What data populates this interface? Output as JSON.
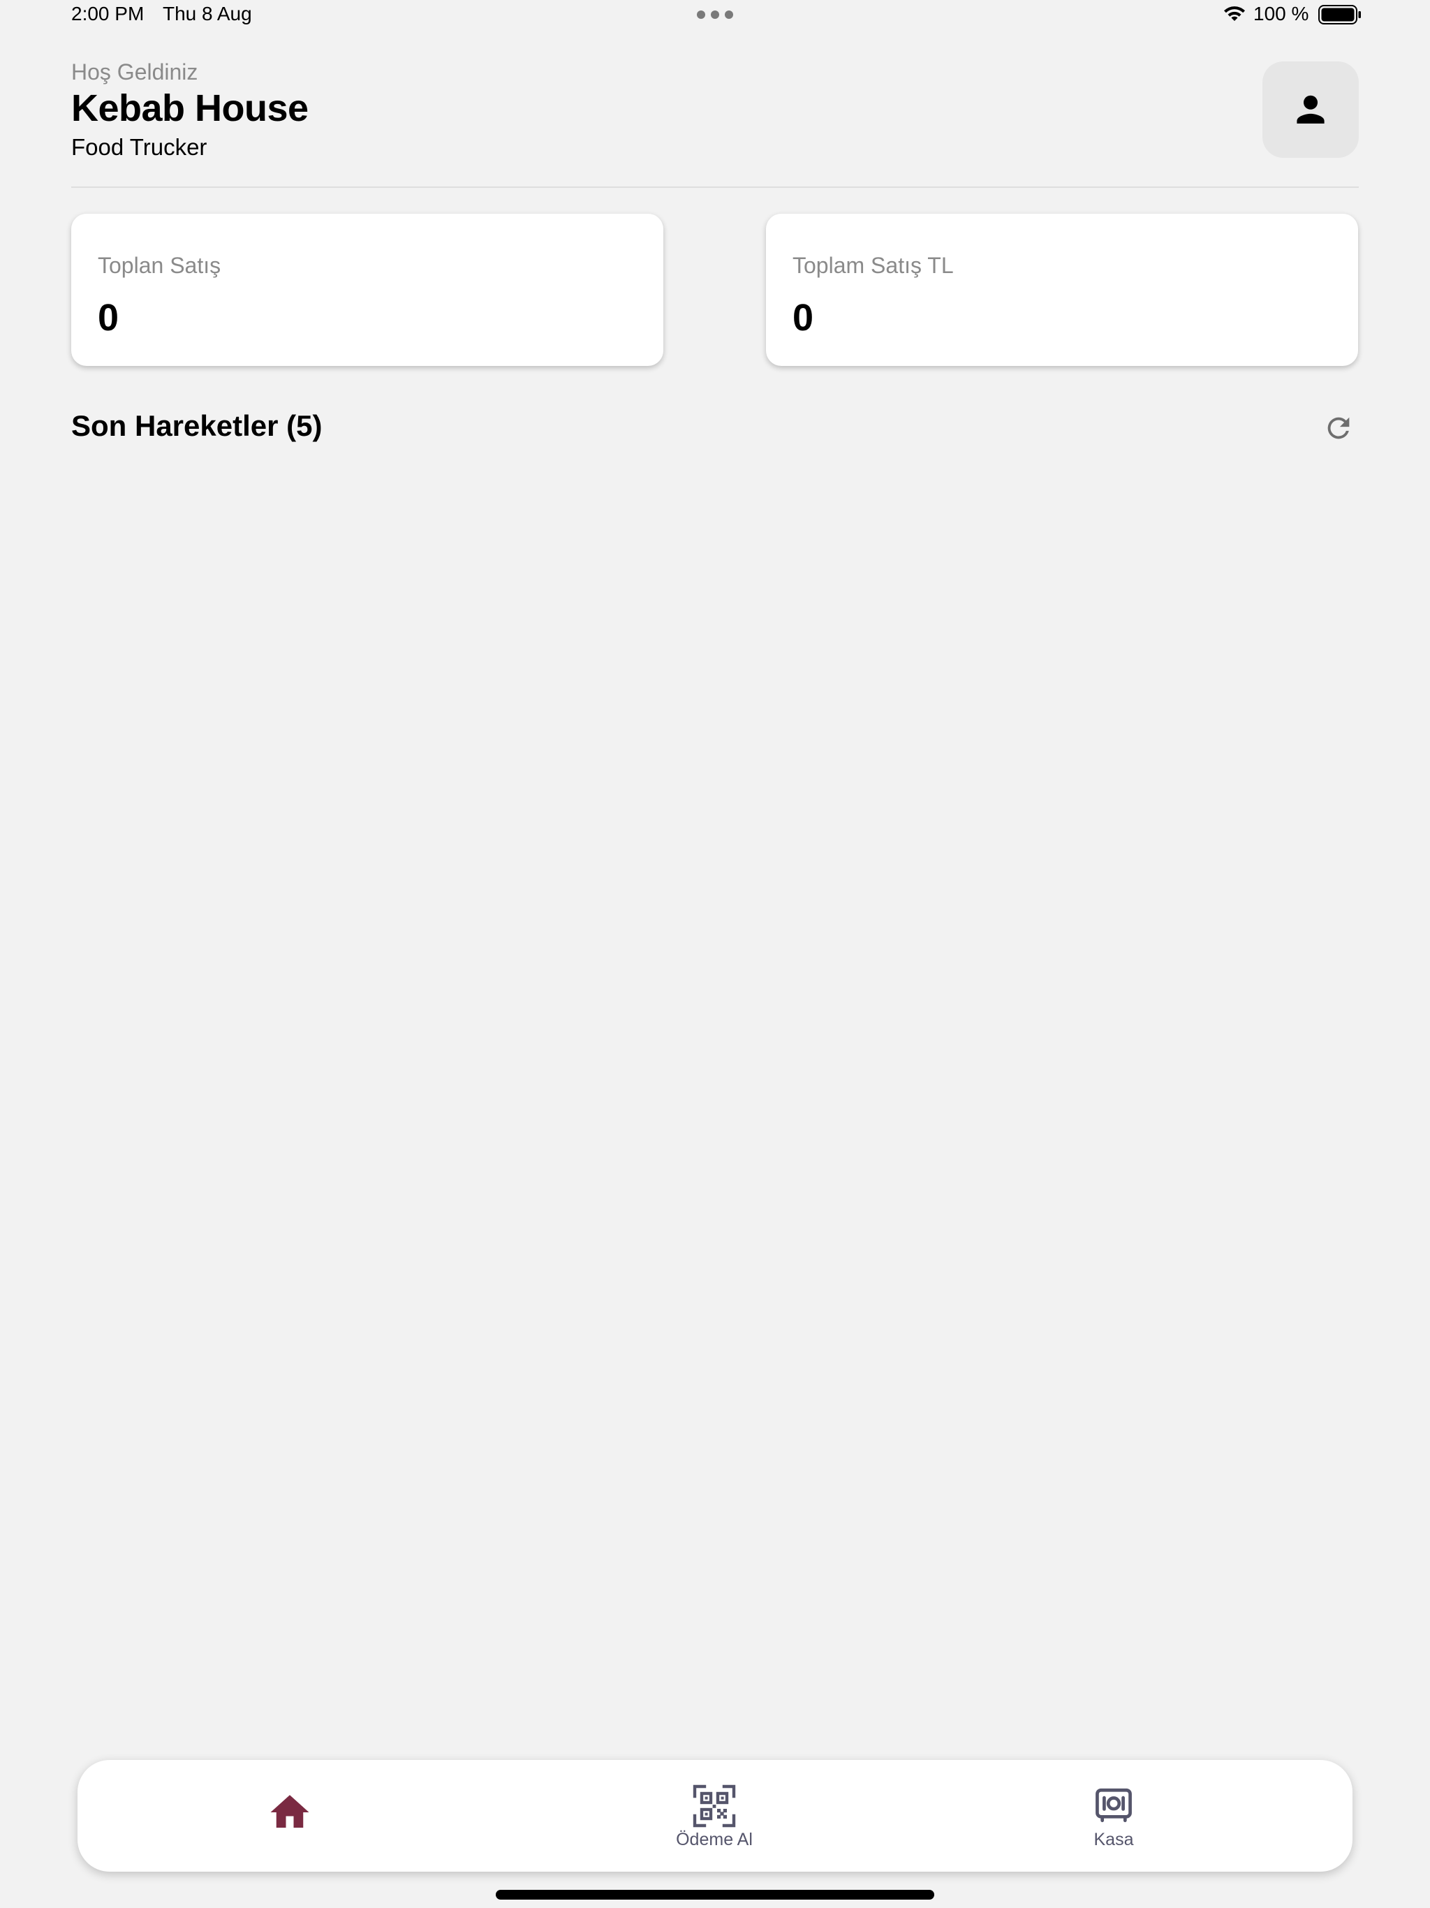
{
  "status_bar": {
    "time": "2:00 PM",
    "date": "Thu 8 Aug",
    "battery": "100 %"
  },
  "header": {
    "welcome": "Hoş Geldiniz",
    "business_name": "Kebab House",
    "business_type": "Food Trucker",
    "profile_icon": "person-icon"
  },
  "stats": [
    {
      "label": "Toplan Satış",
      "value": "0"
    },
    {
      "label": "Toplam Satış TL",
      "value": "0"
    }
  ],
  "recent": {
    "title": "Son Hareketler (5)",
    "refresh_icon": "refresh-icon"
  },
  "tabs": {
    "home": {
      "icon": "home-icon",
      "label": ""
    },
    "payment": {
      "icon": "qr-code-icon",
      "label": "Ödeme Al"
    },
    "kasa": {
      "icon": "safe-icon",
      "label": "Kasa"
    }
  },
  "colors": {
    "accent": "#7a2a42",
    "tab_inactive": "#55556b",
    "background": "#f2f2f2"
  }
}
